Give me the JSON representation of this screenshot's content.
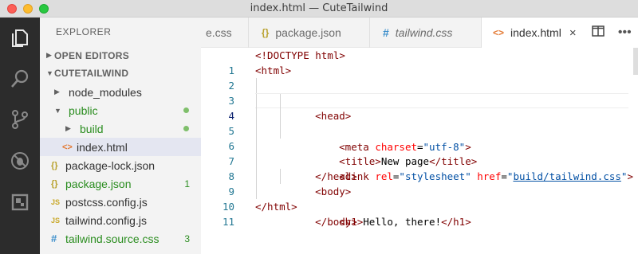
{
  "window": {
    "title": "index.html — CuteTailwind"
  },
  "activity_bar": {
    "items": [
      {
        "icon": "files-icon"
      },
      {
        "icon": "search-icon"
      },
      {
        "icon": "source-control-icon"
      },
      {
        "icon": "debug-icon"
      },
      {
        "icon": "extensions-icon"
      }
    ]
  },
  "sidebar": {
    "title": "EXPLORER",
    "open_editors": "OPEN EDITORS",
    "project": "CUTETAILWIND",
    "items": [
      {
        "label": "node_modules",
        "icon": "",
        "badge": ""
      },
      {
        "label": "public",
        "icon": "",
        "badge": ""
      },
      {
        "label": "build",
        "icon": "",
        "badge": ""
      },
      {
        "label": "index.html",
        "icon": "<>",
        "badge": ""
      },
      {
        "label": "package-lock.json",
        "icon": "{}",
        "badge": ""
      },
      {
        "label": "package.json",
        "icon": "{}",
        "badge": "1"
      },
      {
        "label": "postcss.config.js",
        "icon": "JS",
        "badge": ""
      },
      {
        "label": "tailwind.config.js",
        "icon": "JS",
        "badge": ""
      },
      {
        "label": "tailwind.source.css",
        "icon": "#",
        "badge": "3"
      }
    ]
  },
  "tabs": [
    {
      "label": "e.css",
      "icon": ""
    },
    {
      "label": "package.json",
      "icon": "{}"
    },
    {
      "label": "tailwind.css",
      "icon": "#"
    },
    {
      "label": "index.html",
      "icon": "<>",
      "close": "×"
    }
  ],
  "editor": {
    "line_numbers": [
      "1",
      "2",
      "3",
      "4",
      "5",
      "6",
      "7",
      "8",
      "9",
      "10",
      "11"
    ],
    "current_line": 4,
    "lines": {
      "l1": {
        "a": "<!DOCTYPE html>"
      },
      "l2": {
        "a": "<html>"
      },
      "l3": {
        "a": "<head>"
      },
      "l4": {
        "a": "<meta ",
        "b": "charset",
        "c": "=",
        "d": "\"utf-8\"",
        "e": ">"
      },
      "l5": {
        "a": "<title>",
        "b": "New page",
        "c": "</title>"
      },
      "l6": {
        "a": "<link ",
        "b": "rel",
        "c": "=",
        "d": "\"stylesheet\"",
        "e": " href",
        "f": "=",
        "g": "\"",
        "h": "build/tailwind.css",
        "i": "\"",
        "j": ">"
      },
      "l7": {
        "a": "</head>"
      },
      "l8": {
        "a": "<body>"
      },
      "l9": {
        "a": "<h1>",
        "b": "Hello, there!",
        "c": "</h1>"
      },
      "l10": {
        "a": "</body>"
      },
      "l11": {
        "a": "</html>"
      }
    }
  },
  "colors": {
    "activity_bar": "#2c2c2c",
    "sidebar": "#f3f3f3",
    "selected_row": "#e4e6f1",
    "git_added": "#2a8d1f",
    "tag": "#800000",
    "attribute": "#ff0000",
    "string": "#0451a5",
    "line_number": "#237893"
  }
}
